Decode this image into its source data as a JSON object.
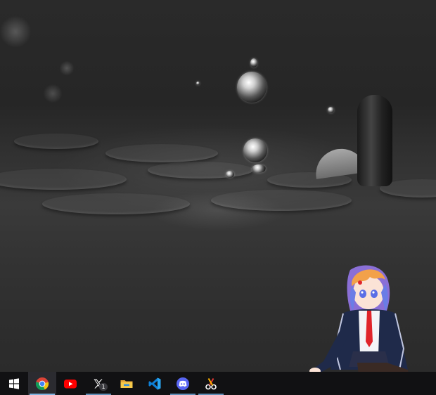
{
  "desktop": {
    "wallpaper": "rain-drops-black-and-white",
    "mascot": "anime-girl-desktop-mascot"
  },
  "taskbar": {
    "background": "#111113",
    "indicator_color": "#7fb3e0",
    "items": [
      {
        "name": "start-button",
        "icon": "windows-logo-icon",
        "active": false,
        "running": false
      },
      {
        "name": "chrome",
        "icon": "chrome-icon",
        "active": true,
        "running": true
      },
      {
        "name": "youtube",
        "icon": "youtube-icon",
        "active": false,
        "running": false
      },
      {
        "name": "x-twitter",
        "icon": "x-logo-icon",
        "active": false,
        "running": true,
        "badge": "1"
      },
      {
        "name": "file-explorer",
        "icon": "folder-icon",
        "active": false,
        "running": false
      },
      {
        "name": "vscode",
        "icon": "vscode-icon",
        "active": false,
        "running": false
      },
      {
        "name": "discord",
        "icon": "discord-icon",
        "active": false,
        "running": true
      },
      {
        "name": "snipping-tool",
        "icon": "scissors-icon",
        "active": false,
        "running": true
      }
    ]
  }
}
